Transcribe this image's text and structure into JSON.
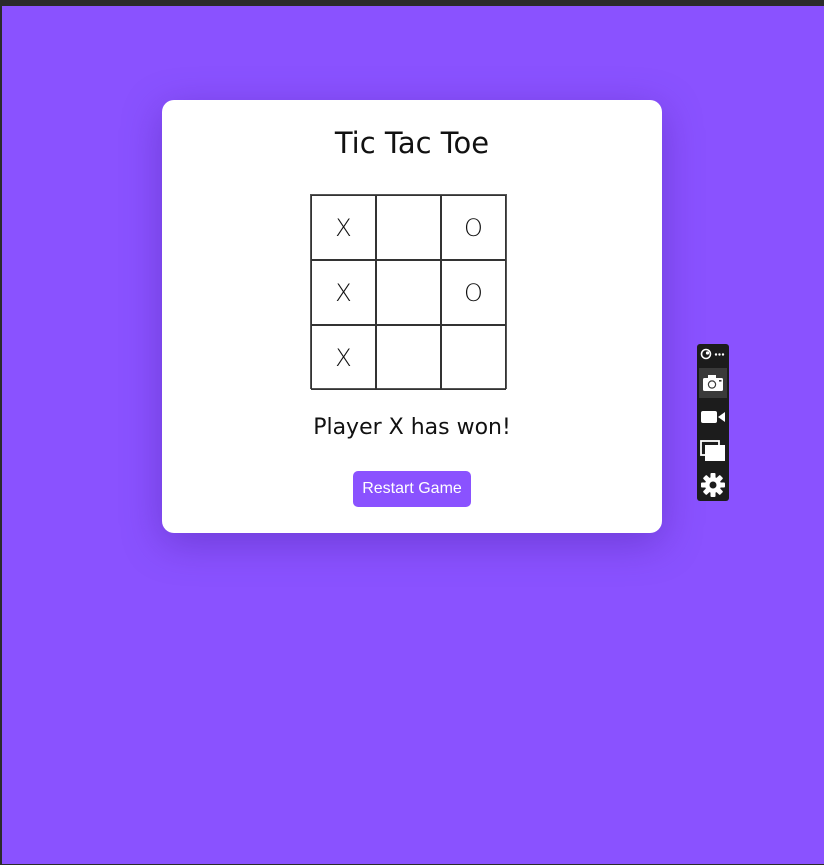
{
  "game": {
    "title": "Tic Tac Toe",
    "board": [
      [
        "X",
        "",
        "O"
      ],
      [
        "X",
        "",
        "O"
      ],
      [
        "X",
        "",
        ""
      ]
    ],
    "status": "Player X has won!",
    "restart_label": "Restart Game"
  },
  "toolbar": {
    "buttons": [
      {
        "name": "camera-icon",
        "active": true
      },
      {
        "name": "video-camera-icon",
        "active": false
      },
      {
        "name": "windows-icon",
        "active": false
      },
      {
        "name": "gear-icon",
        "active": false
      }
    ]
  },
  "colors": {
    "background": "#8a52ff",
    "accent": "#8a52ff",
    "card": "#ffffff"
  }
}
